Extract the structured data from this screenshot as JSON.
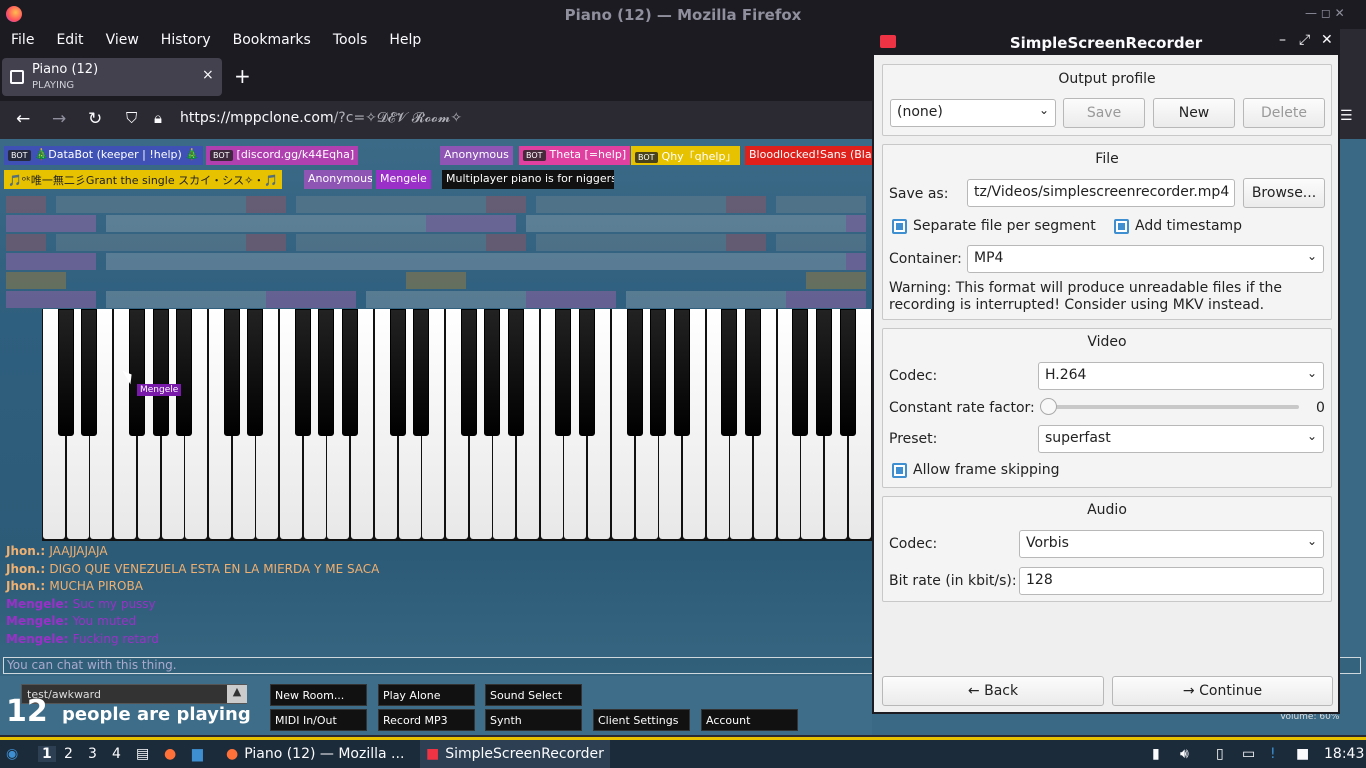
{
  "browser": {
    "window_title": "Piano (12) — Mozilla Firefox",
    "menu": [
      "File",
      "Edit",
      "View",
      "History",
      "Bookmarks",
      "Tools",
      "Help"
    ],
    "tab": {
      "title": "Piano (12)",
      "subtitle": "PLAYING",
      "close": "×"
    },
    "new_tab": "+",
    "url_host": "https://mppclone.com",
    "url_rest": "/?c=✧𝓓𝓔𝓥 𝓡𝓸𝓸𝓶✧"
  },
  "piano_page": {
    "users_row1": [
      {
        "bot": "BOT",
        "name": "🎄DataBot (keeper | !help) 🎄",
        "color": "#3f51b5"
      },
      {
        "bot": "BOT",
        "name": "[discord.gg/k44Eqha]",
        "color": "#b040b0"
      },
      {
        "bot": "",
        "name": "Anonymous",
        "color": "#8e55b5"
      },
      {
        "bot": "BOT",
        "name": "Theta [=help]",
        "color": "#e040a0"
      },
      {
        "bot": "BOT",
        "name": "Qhy「qhelp」",
        "color": "#e6c200"
      },
      {
        "bot": "",
        "name": "Bloodlocked!Sans (Black Hole God)",
        "color": "#e0201a"
      }
    ],
    "users_row2": [
      {
        "name": "🎵ᵒᵏ唯一無二彡Grant the single スカイ・シス✧・🎵",
        "color": "#e6c200"
      },
      {
        "name": "Anonymous",
        "color": "#8e55b5"
      },
      {
        "name": "Mengele",
        "color": "#9a30c8"
      },
      {
        "name": "Multiplayer piano is for niggers",
        "color": "#111111"
      }
    ],
    "chat": [
      {
        "name": "Jhon.:",
        "text": "JAAJJAJAJA",
        "ncolor": "#f0b070",
        "tcolor": "#f0b070"
      },
      {
        "name": "Jhon.:",
        "text": "DIGO QUE VENEZUELA ESTA EN LA MIERDA Y ME SACA",
        "ncolor": "#f0b070",
        "tcolor": "#f0b070"
      },
      {
        "name": "Jhon.:",
        "text": "MUCHA PIROBA",
        "ncolor": "#f0b070",
        "tcolor": "#f0b070"
      },
      {
        "name": "Mengele:",
        "text": "Suc my pussy",
        "ncolor": "#9a30c8",
        "tcolor": "#9a30c8"
      },
      {
        "name": "Mengele:",
        "text": "You muted",
        "ncolor": "#9a30c8",
        "tcolor": "#9a30c8"
      },
      {
        "name": "Mengele:",
        "text": "Fucking retard",
        "ncolor": "#9a30c8",
        "tcolor": "#9a30c8"
      }
    ],
    "cursor_tag": "Mengele",
    "chat_placeholder": "You can chat with this thing.",
    "room": "test/awkward",
    "room_arrow": "▲",
    "player_count": "12",
    "player_text": "people are playing",
    "buttons": [
      "New Room...",
      "Play Alone",
      "Sound Select",
      "MIDI In/Out",
      "Record MP3",
      "Synth",
      "Client Settings",
      "Account"
    ],
    "volume": "Volume: 60%"
  },
  "ssr": {
    "title": "SimpleScreenRecorder",
    "output_profile": {
      "heading": "Output profile",
      "profile": "(none)",
      "save": "Save",
      "new": "New",
      "delete": "Delete"
    },
    "file": {
      "heading": "File",
      "save_as_label": "Save as:",
      "save_as_value": "tz/Videos/simplescreenrecorder.mp4",
      "browse": "Browse...",
      "separate": "Separate file per segment",
      "timestamp": "Add timestamp",
      "container_label": "Container:",
      "container": "MP4",
      "warning": "Warning: This format will produce unreadable files if the recording is interrupted! Consider using MKV instead."
    },
    "video": {
      "heading": "Video",
      "codec_label": "Codec:",
      "codec": "H.264",
      "crf_label": "Constant rate factor:",
      "crf_value": "0",
      "preset_label": "Preset:",
      "preset": "superfast",
      "skip": "Allow frame skipping"
    },
    "audio": {
      "heading": "Audio",
      "codec_label": "Codec:",
      "codec": "Vorbis",
      "bitrate_label": "Bit rate (in kbit/s):",
      "bitrate": "128"
    },
    "back": "Back",
    "continue": "Continue"
  },
  "taskbar": {
    "workspaces": [
      "1",
      "2",
      "3",
      "4"
    ],
    "windows": [
      {
        "label": "Piano (12) — Mozilla ..."
      },
      {
        "label": "SimpleScreenRecorder"
      }
    ],
    "clock": "18:43"
  }
}
